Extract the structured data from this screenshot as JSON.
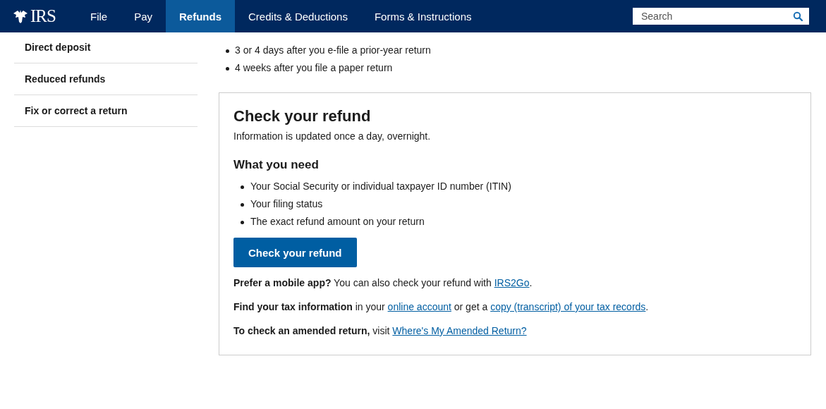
{
  "header": {
    "logo": "IRS",
    "nav": [
      {
        "label": "File",
        "selected": false
      },
      {
        "label": "Pay",
        "selected": false
      },
      {
        "label": "Refunds",
        "selected": true
      },
      {
        "label": "Credits & Deductions",
        "selected": false
      },
      {
        "label": "Forms & Instructions",
        "selected": false
      }
    ],
    "search": {
      "placeholder": "Search"
    }
  },
  "sidebar": {
    "items": [
      {
        "label": "Direct deposit"
      },
      {
        "label": "Reduced refunds"
      },
      {
        "label": "Fix or correct a return"
      }
    ]
  },
  "timing_list": [
    "3 or 4 days after you e-file a prior-year return",
    "4 weeks after you file a paper return"
  ],
  "card": {
    "title": "Check your refund",
    "subtitle": "Information is updated once a day, overnight.",
    "needs_heading": "What you need",
    "needs": [
      "Your Social Security or individual taxpayer ID number (ITIN)",
      "Your filing status",
      "The exact refund amount on your return"
    ],
    "button": "Check your refund",
    "notes": [
      [
        {
          "kind": "bold",
          "text": "Prefer a mobile app?"
        },
        {
          "kind": "text",
          "text": " You can also check your refund with "
        },
        {
          "kind": "link",
          "text": "IRS2Go"
        },
        {
          "kind": "text",
          "text": "."
        }
      ],
      [
        {
          "kind": "bold",
          "text": "Find your tax information"
        },
        {
          "kind": "text",
          "text": " in your "
        },
        {
          "kind": "link",
          "text": "online account"
        },
        {
          "kind": "text",
          "text": " or get a "
        },
        {
          "kind": "link",
          "text": "copy (transcript) of your tax records"
        },
        {
          "kind": "text",
          "text": "."
        }
      ],
      [
        {
          "kind": "bold",
          "text": "To check an amended return,"
        },
        {
          "kind": "text",
          "text": " visit "
        },
        {
          "kind": "link",
          "text": "Where's My Amended Return?"
        }
      ]
    ]
  }
}
